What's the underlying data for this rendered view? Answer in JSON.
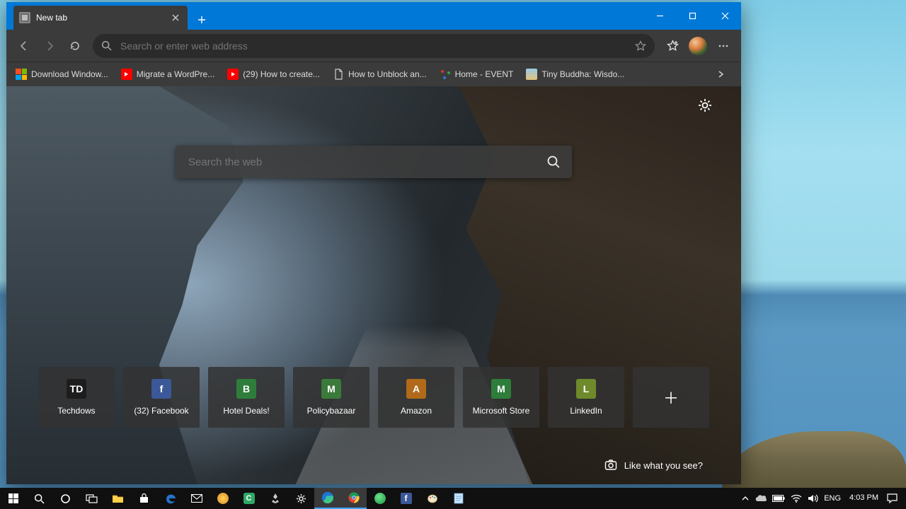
{
  "window": {
    "minimize": "—",
    "maximize": "□",
    "close": "✕"
  },
  "tabs": [
    {
      "title": "New tab"
    }
  ],
  "toolbar": {
    "omnibox_placeholder": "Search or enter web address"
  },
  "bookmarks": [
    {
      "label": "Download Window...",
      "color1": "#f25022",
      "color2": "#7fba00",
      "color3": "#00a4ef",
      "color4": "#ffb900",
      "type": "ms"
    },
    {
      "label": "Migrate a WordPre...",
      "color": "#ff0000",
      "type": "yt"
    },
    {
      "label": "(29) How to create...",
      "color": "#ff0000",
      "type": "yt"
    },
    {
      "label": "How to Unblock an...",
      "type": "page"
    },
    {
      "label": "Home - EVENT",
      "type": "dots"
    },
    {
      "label": "Tiny Buddha: Wisdo...",
      "type": "img"
    }
  ],
  "ntp": {
    "search_placeholder": "Search the web",
    "like_label": "Like what you see?",
    "tiles": [
      {
        "label": "Techdows",
        "letter": "TD",
        "bg": "#1d1d1d",
        "fg": "#ffffff"
      },
      {
        "label": "(32) Facebook",
        "letter": "f",
        "bg": "#3b5998",
        "fg": "#ffffff"
      },
      {
        "label": "Hotel Deals!",
        "letter": "B",
        "bg": "#2f7d3b",
        "fg": "#ffffff"
      },
      {
        "label": "Policybazaar",
        "letter": "M",
        "bg": "#3a7a3a",
        "fg": "#ffffff"
      },
      {
        "label": "Amazon",
        "letter": "A",
        "bg": "#b06a1a",
        "fg": "#ffffff"
      },
      {
        "label": "Microsoft Store",
        "letter": "M",
        "bg": "#2f7d3b",
        "fg": "#ffffff"
      },
      {
        "label": "LinkedIn",
        "letter": "L",
        "bg": "#6f8a2b",
        "fg": "#ffffff"
      }
    ],
    "add_tile_glyph": "＋"
  },
  "systray": {
    "lang": "ENG",
    "time": "4:03 PM"
  }
}
